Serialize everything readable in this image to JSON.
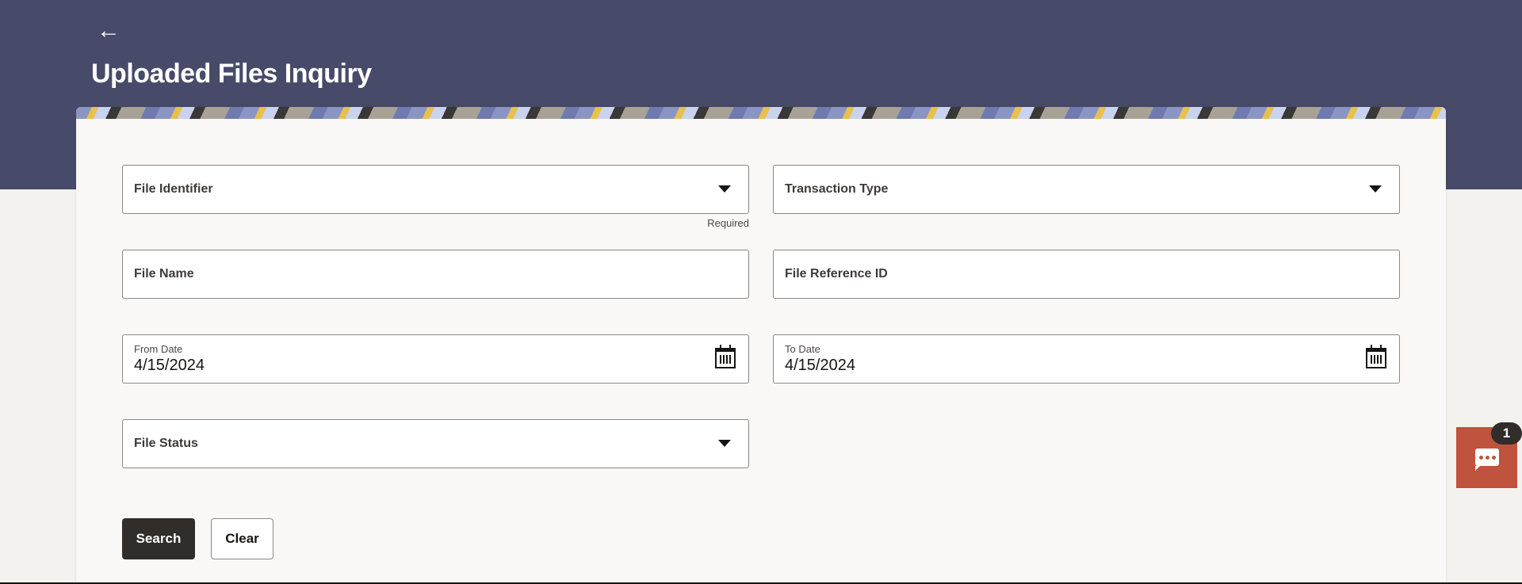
{
  "header": {
    "back_icon": "←",
    "title": "Uploaded Files Inquiry"
  },
  "form": {
    "file_identifier": {
      "label": "File Identifier",
      "helper": "Required"
    },
    "transaction_type": {
      "label": "Transaction Type"
    },
    "file_name": {
      "label": "File Name"
    },
    "file_reference_id": {
      "label": "File Reference ID"
    },
    "from_date": {
      "label": "From Date",
      "value": "4/15/2024"
    },
    "to_date": {
      "label": "To Date",
      "value": "4/15/2024"
    },
    "file_status": {
      "label": "File Status"
    }
  },
  "actions": {
    "search": "Search",
    "clear": "Clear"
  },
  "chat": {
    "badge_count": "1"
  },
  "colors": {
    "header": "#474b69",
    "primary_button": "#312d2a",
    "chat": "#c0533e"
  }
}
